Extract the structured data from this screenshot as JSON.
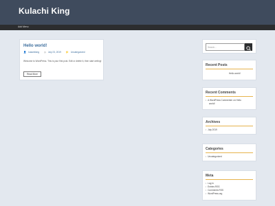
{
  "site": {
    "title": "Kulachi King"
  },
  "nav": {
    "items": [
      "Add Menu"
    ]
  },
  "post": {
    "title": "Hello world!",
    "author": "kulachiking",
    "date": "July 23, 2019",
    "category": "Uncategorized",
    "excerpt": "Welcome to WordPress. This is your first post. Edit or delete it, then start writing!",
    "read_more": "Read More"
  },
  "search": {
    "placeholder": "Search..."
  },
  "widgets": {
    "recent_posts": {
      "title": "Recent Posts",
      "items": [
        "Hello world!"
      ]
    },
    "recent_comments": {
      "title": "Recent Comments",
      "items": [
        "A WordPress Commenter on Hello",
        "world!"
      ]
    },
    "archives": {
      "title": "Archives",
      "items": [
        "July 2019"
      ]
    },
    "categories": {
      "title": "Categories",
      "items": [
        "Uncategorized"
      ]
    },
    "meta": {
      "title": "Meta",
      "items": [
        "Log in",
        "Entries RSS",
        "Comments RSS",
        "WordPress.org"
      ]
    }
  },
  "colors": {
    "header": "#3f4b5d",
    "navbar": "#2c2d2f",
    "accent": "#e6b24a",
    "link": "#3a6c9c",
    "background": "#e3e8ef"
  },
  "icons": {
    "author": "user-icon",
    "date": "clock-icon",
    "category": "folder-icon",
    "search": "search-icon"
  }
}
